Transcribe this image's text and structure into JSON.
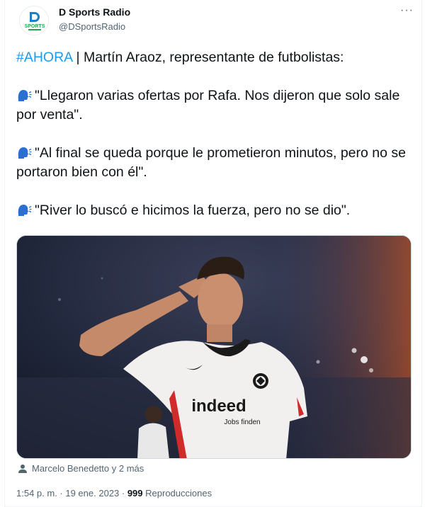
{
  "tweet": {
    "author_name": "D Sports Radio",
    "author_handle": "@DSportsRadio",
    "avatar_text_top": "D",
    "avatar_text_bottom": "SPORTS",
    "more_label": "···",
    "hashtag": "#AHORA",
    "intro": " | Martín Araoz, representante de futbolistas:",
    "quotes": [
      "\"Llegaron varias ofertas por Rafa. Nos dijeron que solo sale por venta\".",
      "\"Al final se queda porque le prometieron minutos, pero no se portaron bien con él\".",
      "\"River lo buscó e hicimos la fuerza, pero no se dio\"."
    ],
    "jersey_sponsor_main": "indeed",
    "jersey_sponsor_sub": "Jobs finden",
    "tagged_people": "Marcelo Benedetto y 2 más",
    "time": "1:54 p. m. · 19 ene. 2023 · ",
    "views_count": "999",
    "views_label": " Reproducciones"
  },
  "colors": {
    "accent": "#1d9bf0",
    "text_primary": "#0f1419",
    "text_secondary": "#536471",
    "speaking_head": "#2b6fd6"
  },
  "icons": [
    "speaking-head-icon",
    "person-icon",
    "more-icon"
  ]
}
